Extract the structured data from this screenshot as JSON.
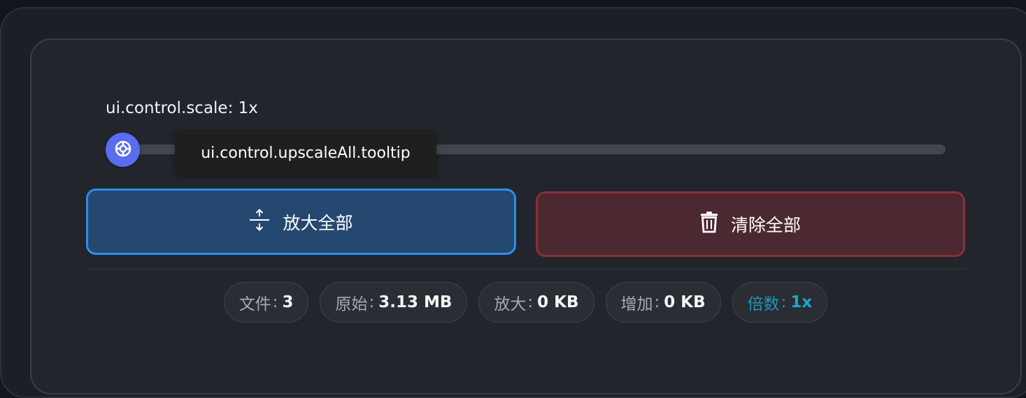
{
  "control": {
    "scale_label": "ui.control.scale: 1x",
    "scale_value_fraction": 0,
    "tooltip": "ui.control.upscaleAll.tooltip"
  },
  "actions": {
    "upscale_all": "放大全部",
    "clear_all": "清除全部"
  },
  "stats": [
    {
      "label": "文件",
      "value": "3"
    },
    {
      "label": "原始",
      "value": "3.13 MB"
    },
    {
      "label": "放大",
      "value": "0 KB"
    },
    {
      "label": "增加",
      "value": "0 KB"
    },
    {
      "label": "倍数",
      "value": "1x"
    }
  ],
  "colors": {
    "accent": "#5a6cf0",
    "primary_border": "#2f8cf0",
    "danger_border": "#8a3038",
    "ratio_accent": "#1ea7cc"
  },
  "icons": {
    "thumb": "lifebuoy-icon",
    "upscale": "expand-vertical-icon",
    "clear": "trash-icon"
  }
}
